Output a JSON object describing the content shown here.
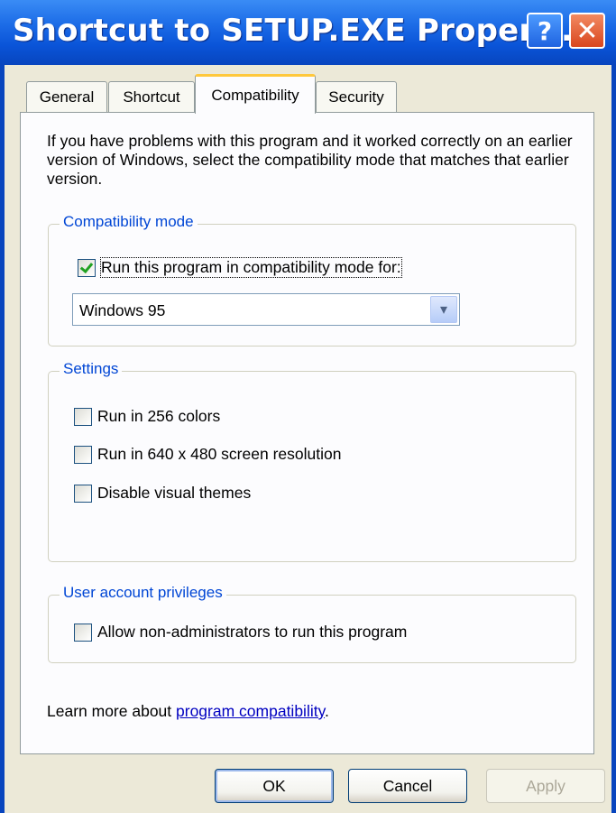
{
  "window": {
    "title": "Shortcut to SETUP.EXE Propert...",
    "help_label": "?",
    "close_label": "✕"
  },
  "tabs": [
    {
      "label": "General",
      "active": false
    },
    {
      "label": "Shortcut",
      "active": false
    },
    {
      "label": "Compatibility",
      "active": true
    },
    {
      "label": "Security",
      "active": false
    }
  ],
  "description": "If you have problems with this program and it worked correctly on an earlier version of Windows, select the compatibility mode that matches that earlier version.",
  "compatibility_mode": {
    "label": "Compatibility mode",
    "checkbox_label": "Run this program in compatibility mode for:",
    "checked": true,
    "selected_os": "Windows 95"
  },
  "settings": {
    "label": "Settings",
    "options": [
      {
        "label": "Run in 256 colors",
        "checked": false
      },
      {
        "label": "Run in 640 x 480 screen resolution",
        "checked": false
      },
      {
        "label": "Disable visual themes",
        "checked": false
      }
    ]
  },
  "privileges": {
    "label": "User account privileges",
    "checkbox_label": "Allow non-administrators to run this program",
    "checked": false
  },
  "learn_more": {
    "prefix": "Learn more about ",
    "link": "program compatibility",
    "suffix": "."
  },
  "buttons": {
    "ok": "OK",
    "cancel": "Cancel",
    "apply": "Apply"
  },
  "colors": {
    "titlebar": "#0A54D8",
    "dialog_bg": "#ECE9D8",
    "group_label": "#0046D5",
    "active_tab_accent": "#FFC83C"
  }
}
